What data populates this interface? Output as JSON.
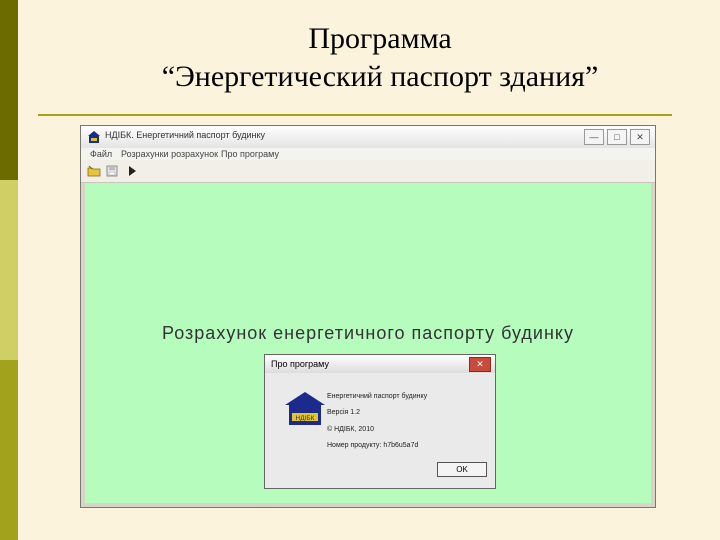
{
  "slide": {
    "title_line1": "Программа",
    "title_line2": "“Энергетический паспорт здания”"
  },
  "window": {
    "title": "НДІБК. Енергетичний паспорт будинку",
    "controls": [
      "—",
      "□",
      "✕"
    ],
    "menu": [
      "Файл",
      "Розрахунки розрахунок",
      "Про програму"
    ],
    "heading": "Розрахунок енергетичного паспорту будинку"
  },
  "dialog": {
    "title": "Про програму",
    "close": "✕",
    "logo_text": "НДІБК",
    "lines": [
      "Енергетичний паспорт будинку",
      "Версія 1.2",
      "© НДІБК, 2010",
      "Номер продукту: h7b6u5a7d"
    ],
    "ok_label": "OK"
  },
  "colors": {
    "client_bg": "#b5fcbd",
    "slide_bg": "#fbf3dc",
    "accent_olive": "#a2a21c"
  }
}
